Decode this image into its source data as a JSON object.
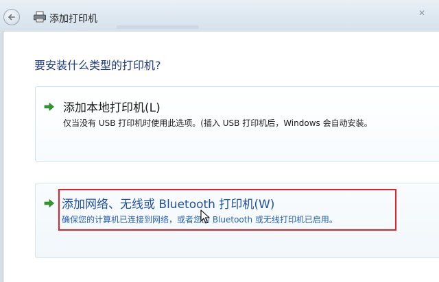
{
  "window": {
    "title": "添加打印机"
  },
  "heading": "要安装什么类型的打印机?",
  "options": {
    "local": {
      "title": "添加本地打印机(L)",
      "description": "仅当没有 USB 打印机时使用此选项。(插入 USB 打印机后，Windows 会自动安装。"
    },
    "network": {
      "title": "添加网络、无线或 Bluetooth 打印机(W)",
      "description": "确保您的计算机已连接到网络，或者您的 Bluetooth 或无线打印机已启用。"
    }
  },
  "colors": {
    "heading": "#1d3a8a",
    "link": "#1f4fa3",
    "arrow": "#2e9a2a",
    "highlight": "#e4202a"
  },
  "icons": {
    "back": "back-arrow-icon",
    "printer": "printer-icon",
    "option_arrow": "green-arrow-icon",
    "cursor": "mouse-cursor"
  }
}
